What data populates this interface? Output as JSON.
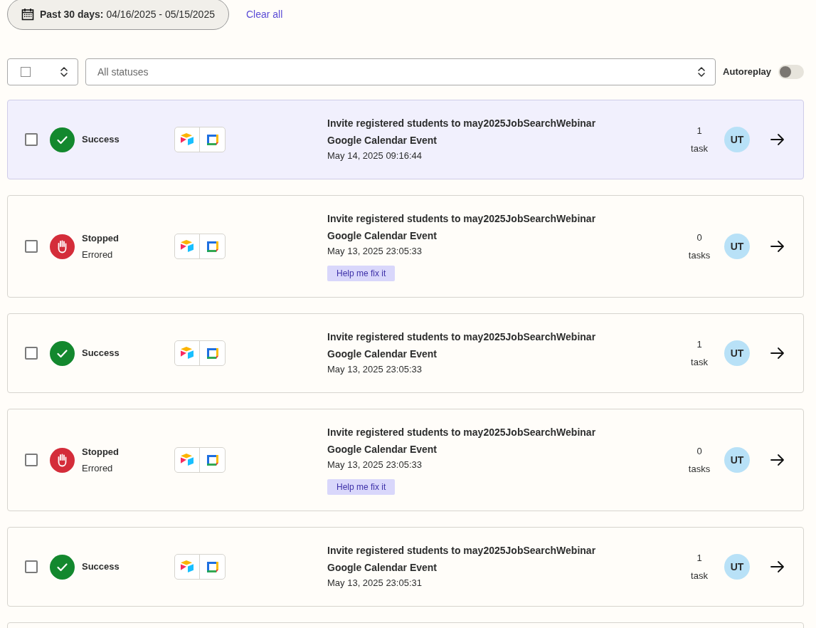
{
  "date_filter": {
    "label": "Past 30 days:",
    "range": "04/16/2025 - 05/15/2025"
  },
  "clear_all": "Clear all",
  "bulk_select": {
    "checked": false
  },
  "status_filter": {
    "value": "All statuses"
  },
  "autoreplay": {
    "label": "Autoreplay",
    "on": false
  },
  "runs": [
    {
      "selected": true,
      "checked": false,
      "status": {
        "kind": "success",
        "label": "Success"
      },
      "title": "Invite registered students to may2025JobSearchWebinar",
      "subtitle": "Google Calendar Event",
      "time": "May 14, 2025 09:16:44",
      "count": "1",
      "unit": "task",
      "avatar": "UT"
    },
    {
      "selected": false,
      "checked": false,
      "status": {
        "kind": "stopped",
        "label": "Stopped",
        "detail": "Errored"
      },
      "title": "Invite registered students to may2025JobSearchWebinar",
      "subtitle": "Google Calendar Event",
      "time": "May 13, 2025 23:05:33",
      "help": "Help me fix it",
      "count": "0",
      "unit": "tasks",
      "avatar": "UT"
    },
    {
      "selected": false,
      "checked": false,
      "status": {
        "kind": "success",
        "label": "Success"
      },
      "title": "Invite registered students to may2025JobSearchWebinar",
      "subtitle": "Google Calendar Event",
      "time": "May 13, 2025 23:05:33",
      "count": "1",
      "unit": "task",
      "avatar": "UT"
    },
    {
      "selected": false,
      "checked": false,
      "status": {
        "kind": "stopped",
        "label": "Stopped",
        "detail": "Errored"
      },
      "title": "Invite registered students to may2025JobSearchWebinar",
      "subtitle": "Google Calendar Event",
      "time": "May 13, 2025 23:05:33",
      "help": "Help me fix it",
      "count": "0",
      "unit": "tasks",
      "avatar": "UT"
    },
    {
      "selected": false,
      "checked": false,
      "status": {
        "kind": "success",
        "label": "Success"
      },
      "title": "Invite registered students to may2025JobSearchWebinar",
      "subtitle": "Google Calendar Event",
      "time": "May 13, 2025 23:05:31",
      "count": "1",
      "unit": "task",
      "avatar": "UT"
    }
  ]
}
